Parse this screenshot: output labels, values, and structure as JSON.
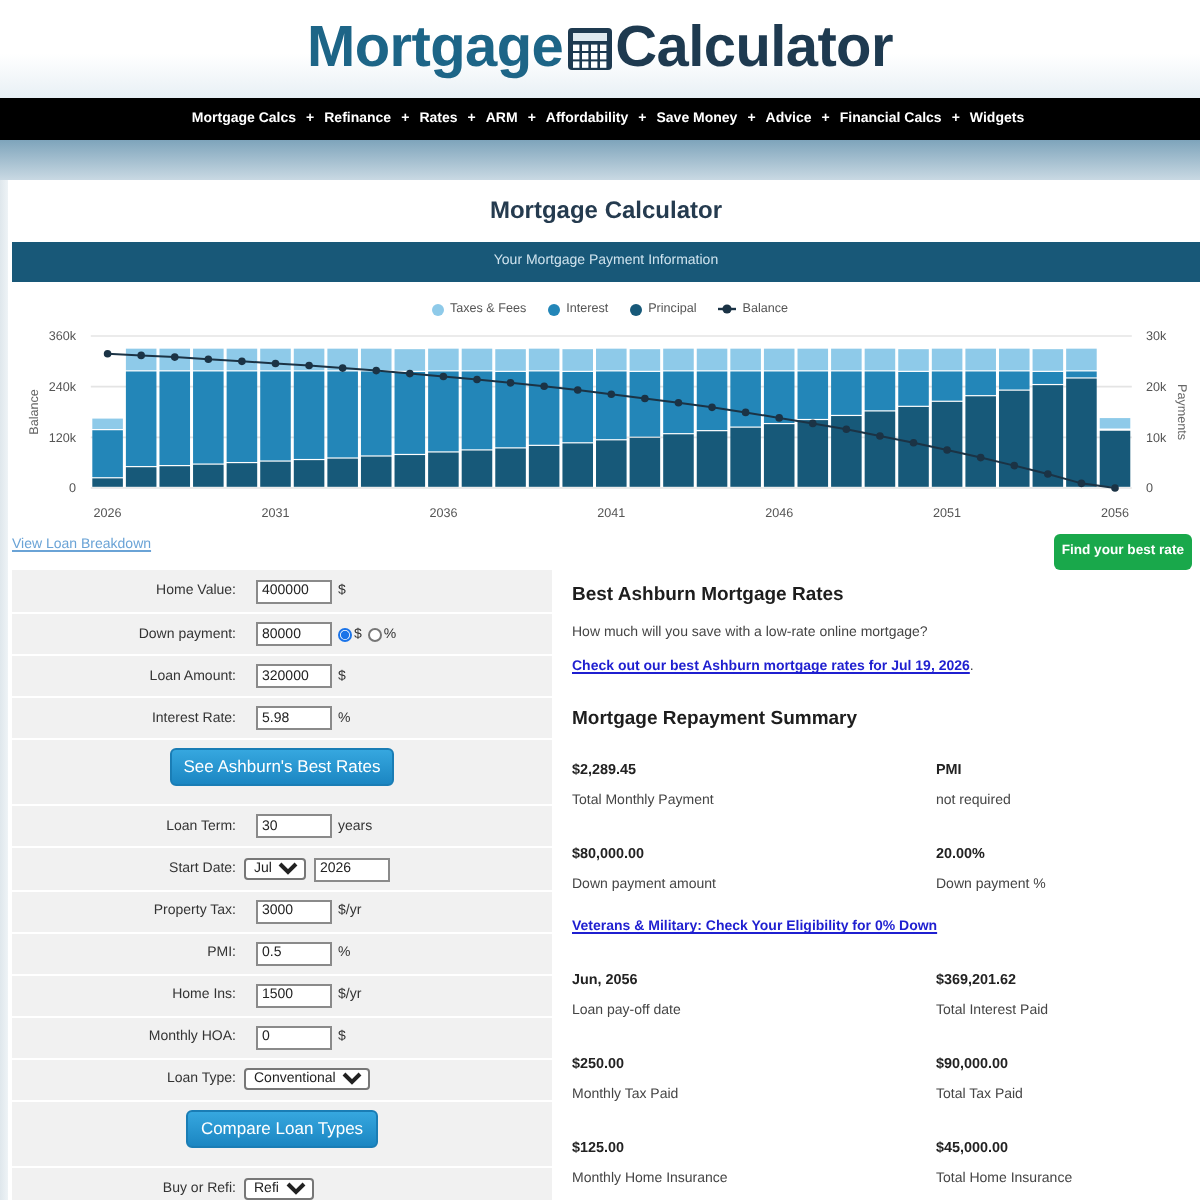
{
  "header": {
    "logo_left": "Mortgage",
    "logo_right": "Calculator"
  },
  "nav": {
    "separator": "+",
    "items": [
      "Mortgage Calcs",
      "Refinance",
      "Rates",
      "ARM",
      "Affordability",
      "Save Money",
      "Advice",
      "Financial Calcs",
      "Widgets"
    ]
  },
  "page": {
    "title": "Mortgage Calculator",
    "banner": "Your Mortgage Payment Information"
  },
  "chart": {
    "chart_data": {
      "type": "bar",
      "stacked": true,
      "legend": "top",
      "x": [
        2026,
        2027,
        2028,
        2029,
        2030,
        2031,
        2032,
        2033,
        2034,
        2035,
        2036,
        2037,
        2038,
        2039,
        2040,
        2041,
        2042,
        2043,
        2044,
        2045,
        2046,
        2047,
        2048,
        2049,
        2050,
        2051,
        2052,
        2053,
        2054,
        2055,
        2056
      ],
      "xlim": [
        2025.5,
        2056.5
      ],
      "xticks": [
        2026,
        2031,
        2036,
        2041,
        2046,
        2051,
        2056
      ],
      "ylabel": "Balance",
      "ylim": [
        0,
        360000
      ],
      "yticks": [
        {
          "value": 0,
          "label": "0"
        },
        {
          "value": 120000,
          "label": "120k"
        },
        {
          "value": 240000,
          "label": "240k"
        },
        {
          "value": 360000,
          "label": "360k"
        }
      ],
      "y2label": "Payments",
      "y2lim": [
        0,
        30000
      ],
      "y2ticks": [
        {
          "value": 0,
          "label": "0"
        },
        {
          "value": 10000,
          "label": "10k"
        },
        {
          "value": 20000,
          "label": "20k"
        },
        {
          "value": 30000,
          "label": "30k"
        }
      ],
      "series": [
        {
          "name": "Taxes & Fees",
          "color": "#8ecae9",
          "type": "bar",
          "axis": "y2",
          "values": [
            2300,
            4500,
            4500,
            4500,
            4500,
            4500,
            4500,
            4500,
            4500,
            4500,
            4500,
            4500,
            4500,
            4500,
            4500,
            4500,
            4500,
            4500,
            4500,
            4500,
            4500,
            4500,
            4500,
            4500,
            4500,
            4500,
            4500,
            4500,
            4500,
            4500,
            2300
          ]
        },
        {
          "name": "Interest",
          "color": "#2386b8",
          "type": "bar",
          "axis": "y2",
          "values": [
            9500,
            18900,
            18700,
            18400,
            18100,
            17800,
            17500,
            17200,
            16800,
            16400,
            16000,
            15600,
            15100,
            14700,
            14100,
            13600,
            13000,
            12400,
            11800,
            11100,
            10400,
            9600,
            8800,
            7900,
            6900,
            6000,
            4900,
            3800,
            2600,
            1400,
            200
          ]
        },
        {
          "name": "Principal",
          "color": "#175979",
          "type": "bar",
          "axis": "y2",
          "values": [
            1900,
            4100,
            4300,
            4600,
            4900,
            5200,
            5500,
            5800,
            6200,
            6500,
            7000,
            7400,
            7800,
            8300,
            8800,
            9400,
            9900,
            10600,
            11200,
            11900,
            12600,
            13400,
            14200,
            15100,
            16000,
            17000,
            18100,
            19200,
            20300,
            21600,
            11300
          ]
        },
        {
          "name": "Balance",
          "color": "#1b3345",
          "type": "line",
          "marker": "circle",
          "values": [
            318000,
            314000,
            310000,
            305000,
            300000,
            295000,
            290000,
            284000,
            278000,
            271000,
            264000,
            257000,
            249000,
            241000,
            232000,
            222000,
            212000,
            202000,
            191000,
            179000,
            166000,
            153000,
            139000,
            123000,
            107000,
            90000,
            72000,
            53000,
            33000,
            11000,
            0
          ]
        }
      ]
    }
  },
  "breakdown_link": "View Loan Breakdown",
  "best_rate_button": "Find your best rate",
  "form": {
    "rows": [
      {
        "kind": "input",
        "label": "Home Value:",
        "value": "400000",
        "unit": "$"
      },
      {
        "kind": "input",
        "label": "Down payment:",
        "value": "80000",
        "options": [
          {
            "label": "$",
            "selected": true
          },
          {
            "label": "%",
            "selected": false
          }
        ]
      },
      {
        "kind": "input",
        "label": "Loan Amount:",
        "value": "320000",
        "unit": "$"
      },
      {
        "kind": "input",
        "label": "Interest Rate:",
        "value": "5.98",
        "unit": "%"
      },
      {
        "kind": "button",
        "label": "See Ashburn's Best Rates"
      },
      {
        "kind": "input",
        "label": "Loan Term:",
        "value": "30",
        "unit": "years"
      },
      {
        "kind": "date",
        "label": "Start Date:",
        "month": "Jul",
        "year": "2026"
      },
      {
        "kind": "input",
        "label": "Property Tax:",
        "value": "3000",
        "unit": "$/yr"
      },
      {
        "kind": "input",
        "label": "PMI:",
        "value": "0.5",
        "unit": "%"
      },
      {
        "kind": "input",
        "label": "Home Ins:",
        "value": "1500",
        "unit": "$/yr"
      },
      {
        "kind": "input",
        "label": "Monthly HOA:",
        "value": "0",
        "unit": "$"
      },
      {
        "kind": "select",
        "label": "Loan Type:",
        "value": "Conventional"
      },
      {
        "kind": "button",
        "label": "Compare Loan Types"
      },
      {
        "kind": "select",
        "label": "Buy or Refi:",
        "value": "Refi"
      }
    ]
  },
  "rates": {
    "heading": "Best Ashburn Mortgage Rates",
    "question": "How much will you save with a low-rate online mortgage?",
    "link": "Check out our best Ashburn mortgage rates for Jul 19, 2026",
    "link_suffix": "."
  },
  "summary": {
    "heading": "Mortgage Repayment Summary",
    "items": [
      {
        "kind": "stat",
        "value": "$2,289.45",
        "label": "Total Monthly Payment"
      },
      {
        "kind": "stat",
        "value": "PMI",
        "label": "not required"
      },
      {
        "kind": "stat",
        "value": "$80,000.00",
        "label": "Down payment amount"
      },
      {
        "kind": "stat",
        "value": "20.00%",
        "label": "Down payment %"
      },
      {
        "kind": "link",
        "text": "Veterans & Military: Check Your Eligibility for 0% Down"
      },
      {
        "kind": "stat",
        "value": "Jun, 2056",
        "label": "Loan pay-off date"
      },
      {
        "kind": "stat",
        "value": "$369,201.62",
        "label": "Total Interest Paid"
      },
      {
        "kind": "stat",
        "value": "$250.00",
        "label": "Monthly Tax Paid"
      },
      {
        "kind": "stat",
        "value": "$90,000.00",
        "label": "Total Tax Paid"
      },
      {
        "kind": "stat",
        "value": "$125.00",
        "label": "Monthly Home Insurance"
      },
      {
        "kind": "stat",
        "value": "$45,000.00",
        "label": "Total Home Insurance"
      }
    ]
  }
}
